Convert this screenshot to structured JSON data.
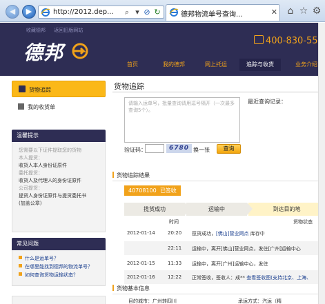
{
  "browser": {
    "url": "http://2012.dep...",
    "tab_title": "德邦物流单号查询...",
    "icons": [
      "back-icon",
      "forward-icon",
      "ie-icon",
      "search-icon",
      "refresh-icon",
      "stop-icon",
      "close-icon",
      "home-icon",
      "star-icon",
      "gear-icon"
    ]
  },
  "header": {
    "top_links": [
      "收藏德邦",
      "返回旧版网站"
    ],
    "logo": "德邦",
    "phone": "400-830-555",
    "nav": [
      "首页",
      "我的德邦",
      "网上托运",
      "追踪与收货",
      "业务介绍"
    ],
    "active_nav": "追踪与收货",
    "colors": {
      "header_bg": "#2e2d54",
      "accent": "#f1a21a"
    }
  },
  "sidebar": {
    "track_label": "货物追踪",
    "address_label": "我的收货单",
    "tips_title": "温馨提示",
    "tips": [
      {
        "text": "您需要以下证件提取您的货物",
        "style": "g"
      },
      {
        "text": "本人提货：",
        "style": "g"
      },
      {
        "text": "收货人本人身份证原件",
        "style": "b"
      },
      {
        "text": "委托提货：",
        "style": "g"
      },
      {
        "text": "收货人及代理人的身份证原件",
        "style": "b"
      },
      {
        "text": "公司提货：",
        "style": "g"
      },
      {
        "text": "提货人身份证原件与提货委托书",
        "style": "b"
      },
      {
        "text": "(加盖公章)",
        "style": "b"
      }
    ],
    "faq_title": "常见问题",
    "faq": [
      "什么是运单号？",
      "在哪里能找到德邦的物流单号？",
      "如何查询货物运输状态？"
    ]
  },
  "main": {
    "title": "货物追踪",
    "textarea_placeholder": "请输入运单号，批量查询请用逗号隔开（一次最多查询5个）。",
    "recent_label": "最近查询记录：",
    "captcha_label": "验证码：",
    "captcha_text": "6780",
    "captcha_refresh": "换一张",
    "query_button": "查询",
    "result_title": "货物追踪结果",
    "waybill": "40708100",
    "waybill_status": "已签收",
    "steps": [
      "揽货成功",
      "运输中",
      "到达目的地"
    ],
    "table_headers": {
      "time": "时间",
      "status": "货物状态"
    },
    "rows": [
      {
        "date": "2012-01-14",
        "time": "20:20",
        "status": "揽货成功，",
        "link": "[佛山]营业网点",
        "tail": " 库存中"
      },
      {
        "date": "",
        "time": "22:11",
        "status": "运输中，离开[佛山]营业网点，发往[广州]运输中心",
        "link": "",
        "tail": ""
      },
      {
        "date": "2012-01-15",
        "time": "11:33",
        "status": "运输中，离开[广州]运输中心，发往",
        "link": "",
        "tail": ""
      },
      {
        "date": "2012-01-16",
        "time": "12:22",
        "status": "正常签收，签收人：成**   ",
        "link": "查看签收图(支持北京、上海、",
        "tail": ""
      }
    ],
    "basic_title": "货物基本信息",
    "basic_dest_label": "目的城市：",
    "basic_dest": "广州转四川",
    "basic_ship_label": "承运方式：",
    "basic_ship": "汽运（精"
  }
}
